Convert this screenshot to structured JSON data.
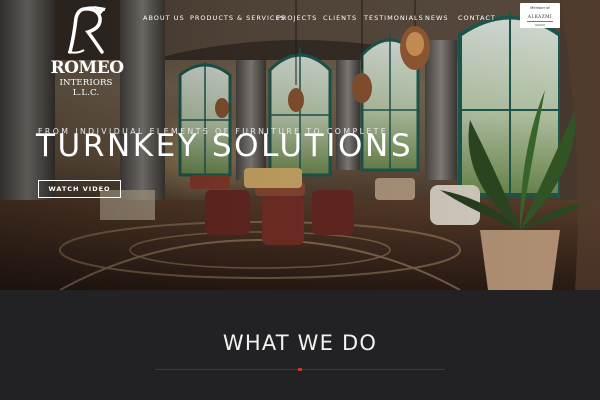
{
  "brand": {
    "name": "ROMEO",
    "subtitle": "INTERIORS L.L.C."
  },
  "nav": {
    "items": [
      {
        "label": "ABOUT US"
      },
      {
        "label": "PRODUCTS & SERVICES"
      },
      {
        "label": "PROJECTS"
      },
      {
        "label": "CLIENTS"
      },
      {
        "label": "TESTIMONIALS"
      },
      {
        "label": "NEWS"
      },
      {
        "label": "CONTACT"
      }
    ]
  },
  "member_badge": {
    "top": "Member of",
    "name": "ALKAZMI",
    "foot": "GROUP"
  },
  "hero": {
    "pretitle": "FROM INDIVIDUAL ELEMENTS OF FURNITURE TO COMPLETE",
    "title": "TURNKEY SOLUTIONS",
    "cta_label": "WATCH VIDEO"
  },
  "section": {
    "title": "WHAT WE DO"
  },
  "colors": {
    "accent": "#c0392b",
    "background": "#222225",
    "text": "#ffffff"
  }
}
